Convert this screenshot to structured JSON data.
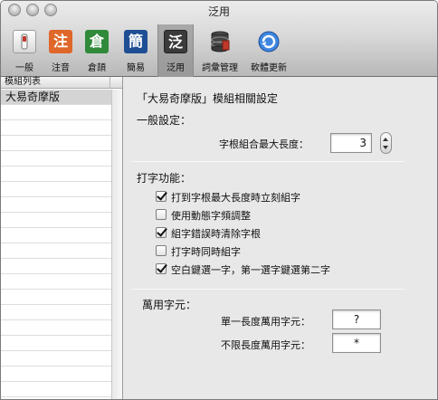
{
  "window": {
    "title": "泛用"
  },
  "toolbar": {
    "items": [
      {
        "label": "一般",
        "glyph": "",
        "color": "#e8e8e8"
      },
      {
        "label": "注音",
        "glyph": "注",
        "color": "#e0672a"
      },
      {
        "label": "倉頡",
        "glyph": "倉",
        "color": "#2f8a3a"
      },
      {
        "label": "簡易",
        "glyph": "簡",
        "color": "#1e4e93"
      },
      {
        "label": "泛用",
        "glyph": "泛",
        "color": "#3a3a3a"
      },
      {
        "label": "詞彙管理",
        "glyph": "",
        "color": "#333333"
      },
      {
        "label": "軟體更新",
        "glyph": "",
        "color": "#2a6fd0"
      }
    ],
    "selected_index": 4
  },
  "sidebar": {
    "header": "模組列表",
    "items": [
      {
        "label": "大易奇摩版",
        "selected": true
      }
    ]
  },
  "main": {
    "module_title": "「大易奇摩版」模組相關設定",
    "general": {
      "heading": "一般設定：",
      "max_len_label": "字根組合最大長度：",
      "max_len_value": "3"
    },
    "typing": {
      "heading": "打字功能：",
      "options": [
        {
          "label": "打到字根最大長度時立刻組字",
          "checked": true
        },
        {
          "label": "使用動態字頻調整",
          "checked": false
        },
        {
          "label": "組字錯誤時清除字根",
          "checked": true
        },
        {
          "label": "打字時同時組字",
          "checked": false
        },
        {
          "label": "空白鍵選一字，第一選字鍵選第二字",
          "checked": true
        }
      ]
    },
    "wildcard": {
      "heading": "萬用字元：",
      "single_label": "單一長度萬用字元：",
      "single_value": "?",
      "unlimited_label": "不限長度萬用字元：",
      "unlimited_value": "*"
    }
  }
}
